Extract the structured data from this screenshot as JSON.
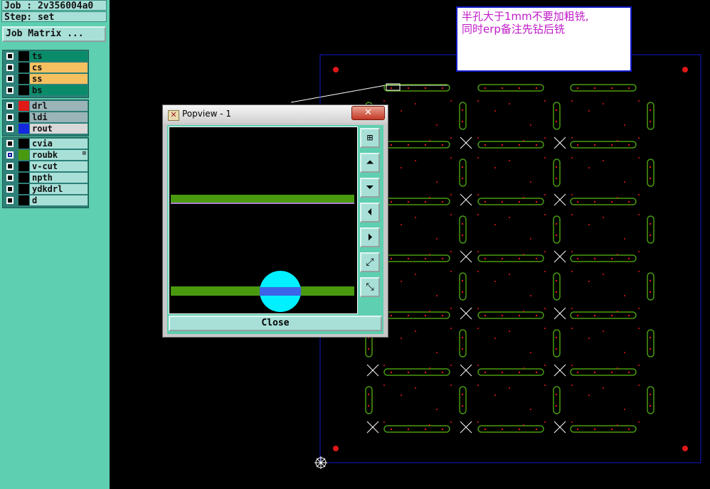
{
  "header": {
    "job": "Job : 2v356004a0",
    "step": "Step: set",
    "job_matrix": "Job Matrix ..."
  },
  "layer_groups": [
    {
      "layers": [
        {
          "name": "ts",
          "color": "#0a8c6a",
          "on": false
        },
        {
          "name": "cs",
          "color": "#f5c060",
          "on": false
        },
        {
          "name": "ss",
          "color": "#f5c060",
          "on": false
        },
        {
          "name": "bs",
          "color": "#0a8c6a",
          "on": false
        }
      ]
    },
    {
      "layers": [
        {
          "name": "drl",
          "color": "#9ab4b8",
          "swatch": "#e01818",
          "on": false
        },
        {
          "name": "ldi",
          "color": "#9ab4b8",
          "swatch": "#000000",
          "on": false
        },
        {
          "name": "rout",
          "color": "#d8d8d8",
          "swatch": "#1428e0",
          "on": false
        }
      ]
    },
    {
      "layers": [
        {
          "name": "cvia",
          "color": "#a8e0d8",
          "on": false
        },
        {
          "name": "roubk",
          "color": "#a8e0d8",
          "swatch": "#4a9a10",
          "on": true,
          "marker": "⊞"
        },
        {
          "name": "v-cut",
          "color": "#a8e0d8",
          "on": false
        },
        {
          "name": "npth",
          "color": "#a8e0d8",
          "on": false
        },
        {
          "name": "ydkdrl",
          "color": "#a8e0d8",
          "on": false
        },
        {
          "name": "d",
          "color": "#a8e0d8",
          "on": false
        }
      ]
    }
  ],
  "note": {
    "line1": "半孔大于1mm不要加粗铣,",
    "line2": "同时erp备注先钻后铣"
  },
  "popview": {
    "title": "Popview - 1",
    "close_x": "✕",
    "close_label": "Close",
    "buttons": [
      {
        "name": "zoom-fit-icon",
        "glyph": "⊞"
      },
      {
        "name": "pan-up-icon",
        "glyph": "⏶"
      },
      {
        "name": "pan-down-icon",
        "glyph": "⏷"
      },
      {
        "name": "pan-left-icon",
        "glyph": "⏴"
      },
      {
        "name": "pan-right-icon",
        "glyph": "⏵"
      },
      {
        "name": "zoom-in-icon",
        "glyph": "⤢"
      },
      {
        "name": "zoom-out-icon",
        "glyph": "⤡"
      }
    ]
  },
  "colors": {
    "panel_bg": "#5ecfb0",
    "outline_blue": "#1419c8",
    "route_green": "#4a9a10",
    "drill_red": "#e01818",
    "annotation_text": "#c01ac8",
    "preview_circle": "#00f0ff"
  }
}
